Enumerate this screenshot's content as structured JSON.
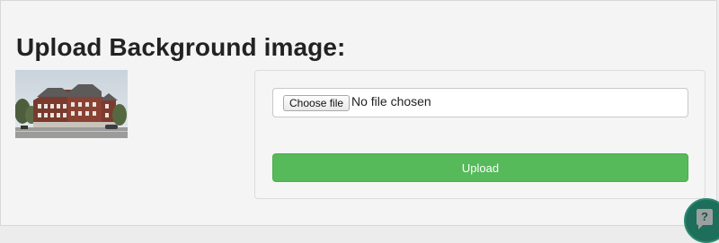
{
  "page": {
    "title": "Upload Background image:"
  },
  "preview": {
    "icon": "building-photo"
  },
  "upload_form": {
    "choose_label": "Choose file",
    "file_status": "No file chosen",
    "upload_label": "Upload",
    "button_color": "#56b95a"
  },
  "help": {
    "glyph": "?",
    "icon": "help-chat-icon",
    "color": "#1d6e5a"
  }
}
